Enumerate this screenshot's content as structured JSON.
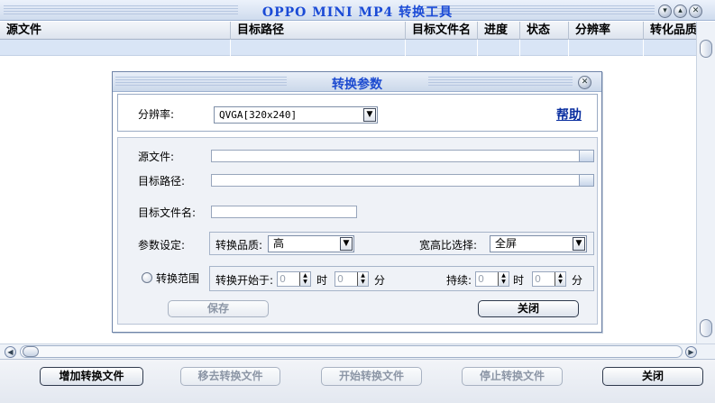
{
  "window": {
    "title": "OPPO MINI MP4 转换工具",
    "controls": [
      "minimize-icon",
      "maximize-icon",
      "close-icon"
    ]
  },
  "table": {
    "columns": [
      "源文件",
      "目标路径",
      "目标文件名",
      "进度",
      "状态",
      "分辨率",
      "转化品质"
    ]
  },
  "bottom_buttons": {
    "add": "增加转换文件",
    "remove": "移去转换文件",
    "start": "开始转换文件",
    "stop": "停止转换文件",
    "close": "关闭"
  },
  "dialog": {
    "title": "转换参数",
    "resolution_label": "分辨率:",
    "resolution_value": "QVGA[320x240]",
    "help": "帮助",
    "source_label": "源文件:",
    "target_path_label": "目标路径:",
    "target_name_label": "目标文件名:",
    "params_label": "参数设定:",
    "quality_label": "转换品质:",
    "quality_value": "高",
    "aspect_label": "宽高比选择:",
    "aspect_value": "全屏",
    "range_label": "转换范围",
    "start_at_label": "转换开始于:",
    "hour_label": "时",
    "minute_label": "分",
    "duration_label": "持续:",
    "start_hour": "0",
    "start_min": "0",
    "dur_hour": "0",
    "dur_min": "0",
    "save": "保存",
    "close": "关闭"
  },
  "colors": {
    "title_blue": "#1a4ad6",
    "row_highlight": "#d9e5f6",
    "disabled_text": "#8c96a6"
  }
}
